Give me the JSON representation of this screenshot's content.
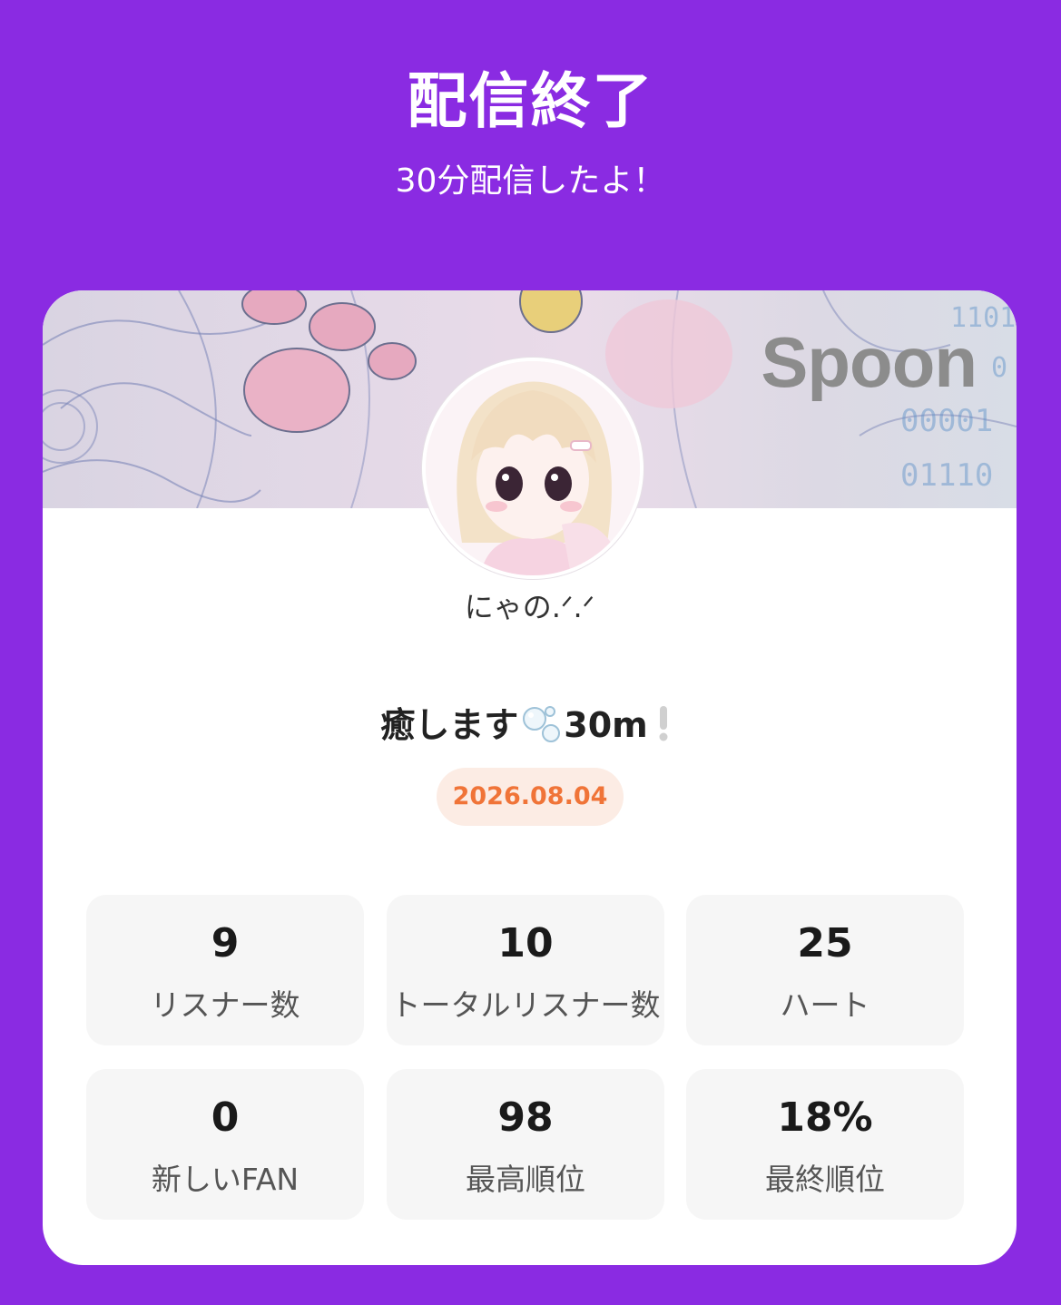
{
  "header": {
    "title": "配信終了",
    "subtitle": "30分配信したよ！"
  },
  "card": {
    "banner_brand": "Spoon",
    "banner_overlay_text": [
      "1101",
      "0",
      "00001",
      "01110"
    ],
    "username": "にゃの.ᐟ.ᐟ",
    "stream_title_prefix": "癒します",
    "stream_title_suffix": "30m",
    "stream_title_emoji": [
      "bubbles-icon",
      "exclamation-icon"
    ],
    "date": "2026.08.04",
    "stats": [
      {
        "value": "9",
        "label": "リスナー数"
      },
      {
        "value": "10",
        "label": "トータルリスナー数"
      },
      {
        "value": "25",
        "label": "ハート"
      },
      {
        "value": "0",
        "label": "新しいFAN"
      },
      {
        "value": "98",
        "label": "最高順位"
      },
      {
        "value": "18%",
        "label": "最終順位"
      }
    ]
  },
  "colors": {
    "background": "#8a2be2",
    "date_text": "#f07438",
    "date_badge": "#fcece4",
    "stat_tile": "#f6f6f6"
  }
}
